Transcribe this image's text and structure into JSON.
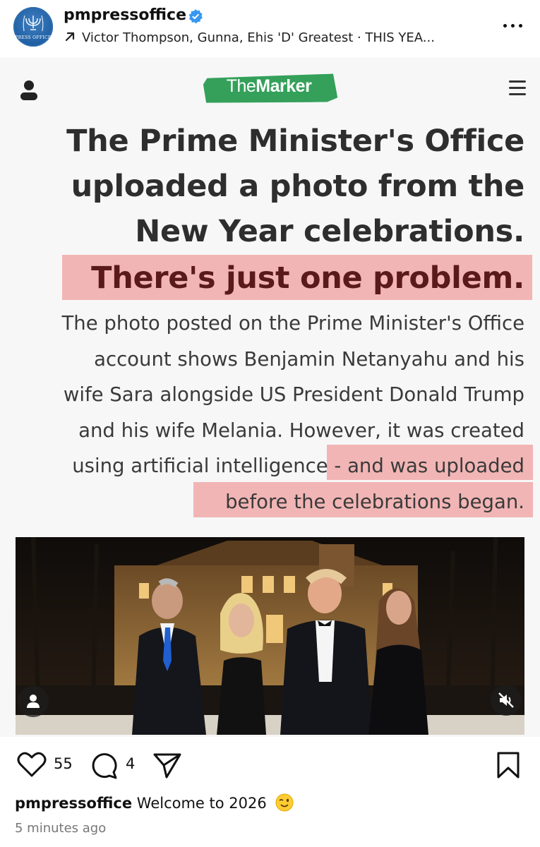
{
  "post": {
    "username": "pmpressoffice",
    "avatar_label": "PRESS OFFICE",
    "music": "Victor Thompson, Gunna, Ehis 'D' Greatest · THIS YEA..."
  },
  "article": {
    "brand_light": "The",
    "brand_bold": "Marker",
    "headline_lines": [
      "The Prime Minister's Office",
      "uploaded a photo from the",
      "New Year celebrations."
    ],
    "headline_highlight": "There's just one problem.",
    "body_lines": [
      "The photo posted on the Prime Minister's Office",
      "account shows Benjamin Netanyahu and his",
      "wife Sara alongside US President Donald Trump",
      "and his wife Melania. However, it was created",
      "using artificial intelligence - and was uploaded",
      "before the celebrations began."
    ]
  },
  "actions": {
    "likes": "55",
    "comments": "4"
  },
  "caption": {
    "username": "pmpressoffice",
    "text": "Welcome to 2026"
  },
  "timestamp": "5 minutes ago",
  "colors": {
    "verified": "#3897f0",
    "highlight": "#f2b5b5",
    "brand_green": "#34a05a",
    "headline_red": "#5a1a1c"
  },
  "icons": [
    "verified-badge-icon",
    "arrow-up-right-icon",
    "more-options-icon",
    "user-icon",
    "menu-icon",
    "tag-people-icon",
    "mute-icon",
    "heart-icon",
    "comment-icon",
    "share-icon",
    "bookmark-icon",
    "wink-emoji-icon"
  ]
}
